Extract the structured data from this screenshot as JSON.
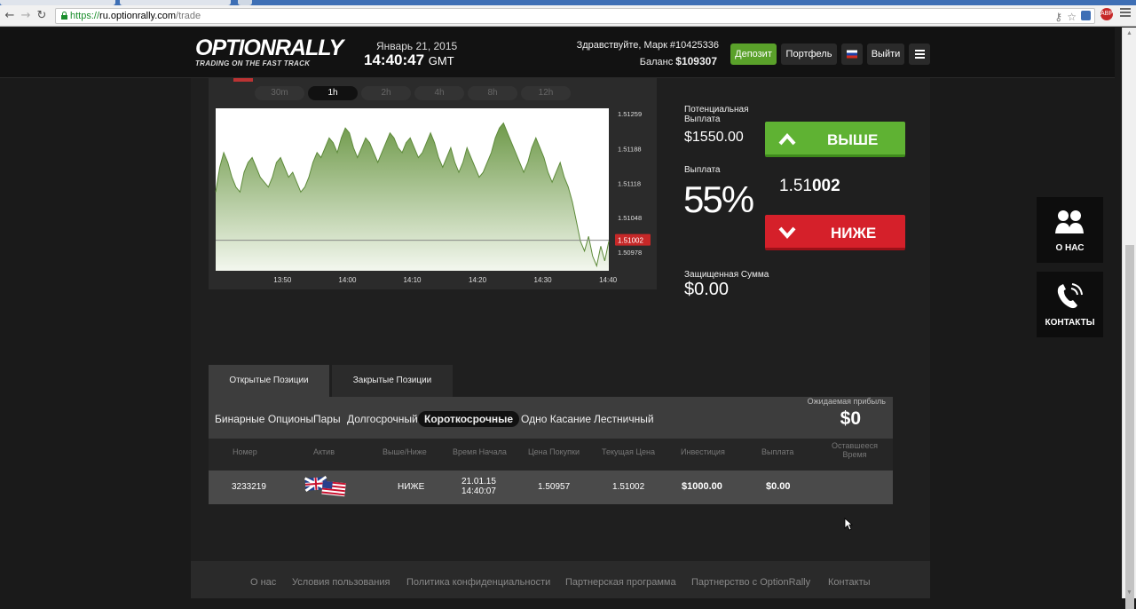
{
  "browser": {
    "url_scheme": "https://",
    "url_host": "ru.optionrally.com",
    "url_path": "/trade"
  },
  "header": {
    "logo": "OPTIONRALLY",
    "tagline": "TRADING ON THE FAST TRACK",
    "date": "Январь 21, 2015",
    "time": "14:40:47",
    "tz": "GMT",
    "greeting": "Здравствуйте, Марк #10425336",
    "balance_label": "Баланс",
    "balance_value": "$109307",
    "deposit": "Депозит",
    "portfolio": "Портфель",
    "logout": "Выйти"
  },
  "chart": {
    "timeframes": [
      "30m",
      "1h",
      "2h",
      "4h",
      "8h",
      "12h"
    ],
    "active_timeframe": "1h",
    "current_price": "1.51002"
  },
  "chart_data": {
    "type": "area",
    "x_ticks": [
      "13:50",
      "14:00",
      "14:10",
      "14:20",
      "14:30",
      "14:40"
    ],
    "y_ticks": [
      "1.51259",
      "1.51188",
      "1.51118",
      "1.51048",
      "1.50978"
    ],
    "ylim": [
      1.5094,
      1.5127
    ],
    "current": 1.51002,
    "values": [
      1.511,
      1.5115,
      1.5118,
      1.5116,
      1.5113,
      1.5111,
      1.511,
      1.5114,
      1.5116,
      1.5117,
      1.5115,
      1.5113,
      1.5112,
      1.5111,
      1.5113,
      1.5116,
      1.5117,
      1.5115,
      1.5113,
      1.5114,
      1.5112,
      1.511,
      1.5111,
      1.5113,
      1.5116,
      1.5118,
      1.5117,
      1.5119,
      1.5121,
      1.512,
      1.5118,
      1.5121,
      1.5123,
      1.5122,
      1.5119,
      1.5117,
      1.5119,
      1.5121,
      1.512,
      1.5118,
      1.5116,
      1.5118,
      1.512,
      1.5122,
      1.5121,
      1.5119,
      1.5118,
      1.512,
      1.5121,
      1.5119,
      1.5117,
      1.5118,
      1.512,
      1.5122,
      1.512,
      1.5117,
      1.5115,
      1.5117,
      1.5119,
      1.5116,
      1.5114,
      1.5116,
      1.5119,
      1.5117,
      1.5115,
      1.5113,
      1.5114,
      1.5116,
      1.5118,
      1.5121,
      1.5123,
      1.5124,
      1.5122,
      1.512,
      1.5118,
      1.5116,
      1.5114,
      1.5116,
      1.5119,
      1.5121,
      1.5119,
      1.5117,
      1.5114,
      1.5112,
      1.5114,
      1.5116,
      1.5113,
      1.5111,
      1.5108,
      1.5104,
      1.51,
      1.5098,
      1.5101,
      1.5097,
      1.5095,
      1.5099,
      1.5096,
      1.51
    ],
    "xlabel": "",
    "ylabel": ""
  },
  "trade": {
    "potential_label": "Потенциальная Выплата",
    "potential_value": "$1550.00",
    "payout_label": "Выплата",
    "payout_pct": "55%",
    "up_label": "ВЫШЕ",
    "down_label": "НИЖЕ",
    "price_prefix": "1.51",
    "price_bold": "002",
    "protected_label": "Защищенная Сумма",
    "protected_value": "$0.00"
  },
  "positions": {
    "tab_open": "Открытые Позиции",
    "tab_closed": "Закрытые Позиции",
    "filters": [
      "Бинарные Опционы",
      "Пары",
      "Долгосрочный",
      "Короткосрочные",
      "Одно Касание",
      "Лестничный"
    ],
    "active_filter": "Короткосрочные",
    "expected_label": "Ожидаемая прибыль",
    "expected_value": "$0",
    "columns": [
      "Номер",
      "Актив",
      "Выше/Ниже",
      "Время Начала",
      "Цена Покупки",
      "Текущая Цена",
      "Инвестиция",
      "Выплата",
      "Оставшееся Время"
    ],
    "rows": [
      {
        "id": "3233219",
        "direction": "НИЖЕ",
        "start_date": "21.01.15",
        "start_time": "14:40:07",
        "buy_price": "1.50957",
        "current_price": "1.51002",
        "investment": "$1000.00",
        "payout": "$0.00"
      }
    ]
  },
  "side": {
    "about": "О НАС",
    "contacts": "КОНТАКТЫ"
  },
  "footer": {
    "links": [
      "О нас",
      "Условия пользования",
      "Политика конфиденциальности",
      "Партнерская программа",
      "Партнерство с OptionRally",
      "Контакты"
    ]
  },
  "colors": {
    "up": "#5fb233",
    "down": "#d5202a",
    "deposit": "#5aa12a",
    "chart_fill": "#6f9a4a"
  }
}
